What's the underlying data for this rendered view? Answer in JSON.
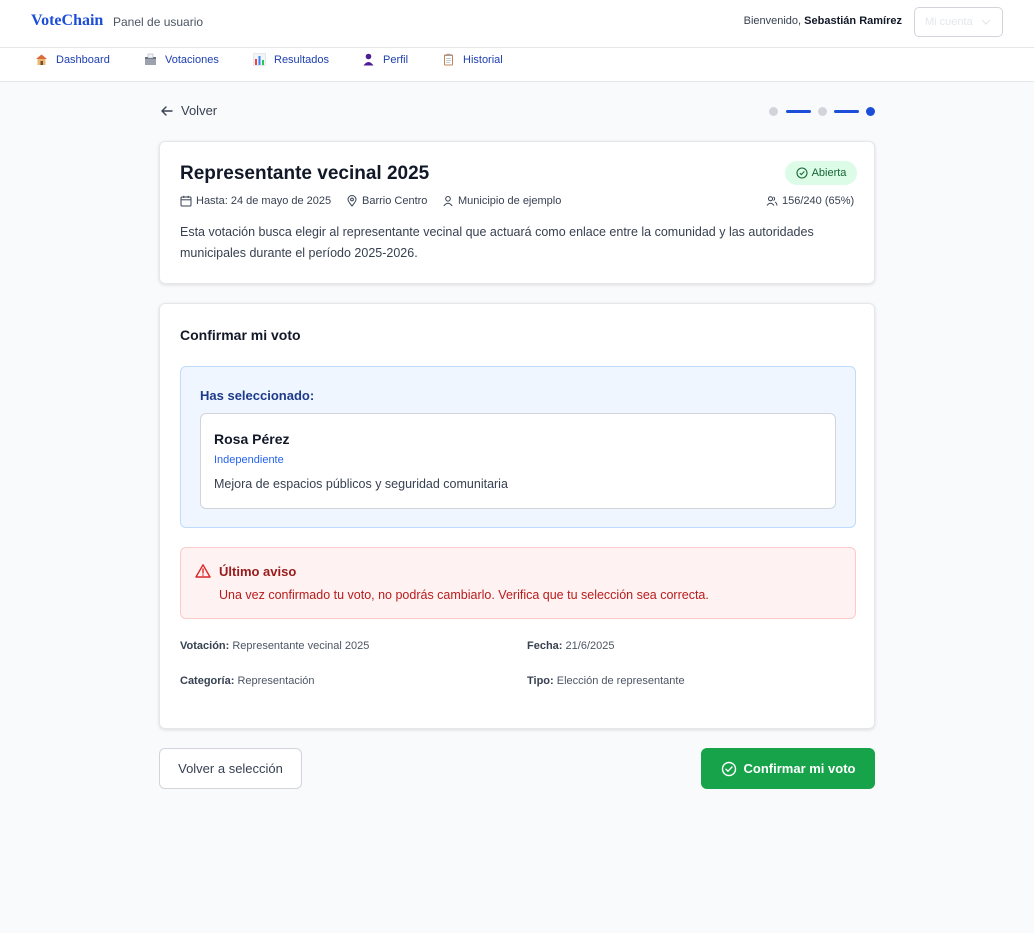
{
  "header": {
    "brand": "VoteChain",
    "subtitle": "Panel de usuario",
    "welcome_prefix": "Bienvenido,",
    "user_name": "Sebastián Ramírez",
    "account_label": "Mi cuenta"
  },
  "nav": {
    "items": [
      {
        "label": "Dashboard",
        "icon": "house-icon"
      },
      {
        "label": "Votaciones",
        "icon": "ballot-box-icon"
      },
      {
        "label": "Resultados",
        "icon": "bar-chart-icon"
      },
      {
        "label": "Perfil",
        "icon": "person-icon"
      },
      {
        "label": "Historial",
        "icon": "clipboard-icon"
      }
    ]
  },
  "page": {
    "back_label": "Volver",
    "steps": {
      "total": 3,
      "current": 3
    }
  },
  "election": {
    "title": "Representante vecinal 2025",
    "status": "Abierta",
    "deadline": "Hasta: 24 de mayo de 2025",
    "location": "Barrio Centro",
    "municipality": "Municipio de ejemplo",
    "participation": "156/240 (65%)",
    "description": "Esta votación busca elegir al representante vecinal que actuará como enlace entre la comunidad y las autoridades municipales durante el período 2025-2026."
  },
  "confirm": {
    "title": "Confirmar mi voto",
    "selected_label": "Has seleccionado:",
    "candidate": {
      "name": "Rosa Pérez",
      "party": "Independiente",
      "proposal": "Mejora de espacios públicos y seguridad comunitaria"
    },
    "warning": {
      "title": "Último aviso",
      "text": "Una vez confirmado tu voto, no podrás cambiarlo. Verifica que tu selección sea correcta."
    },
    "details": {
      "vote_label": "Votación:",
      "vote_value": "Representante vecinal 2025",
      "date_label": "Fecha:",
      "date_value": "21/6/2025",
      "category_label": "Categoría:",
      "category_value": "Representación",
      "type_label": "Tipo:",
      "type_value": "Elección de representante"
    }
  },
  "actions": {
    "back_to_selection": "Volver a selección",
    "confirm_vote": "Confirmar mi voto"
  },
  "colors": {
    "brand": "#1d4ed8",
    "confirm": "#16a34a",
    "warning": "#991b1b",
    "status_bg": "#dcfce7"
  }
}
